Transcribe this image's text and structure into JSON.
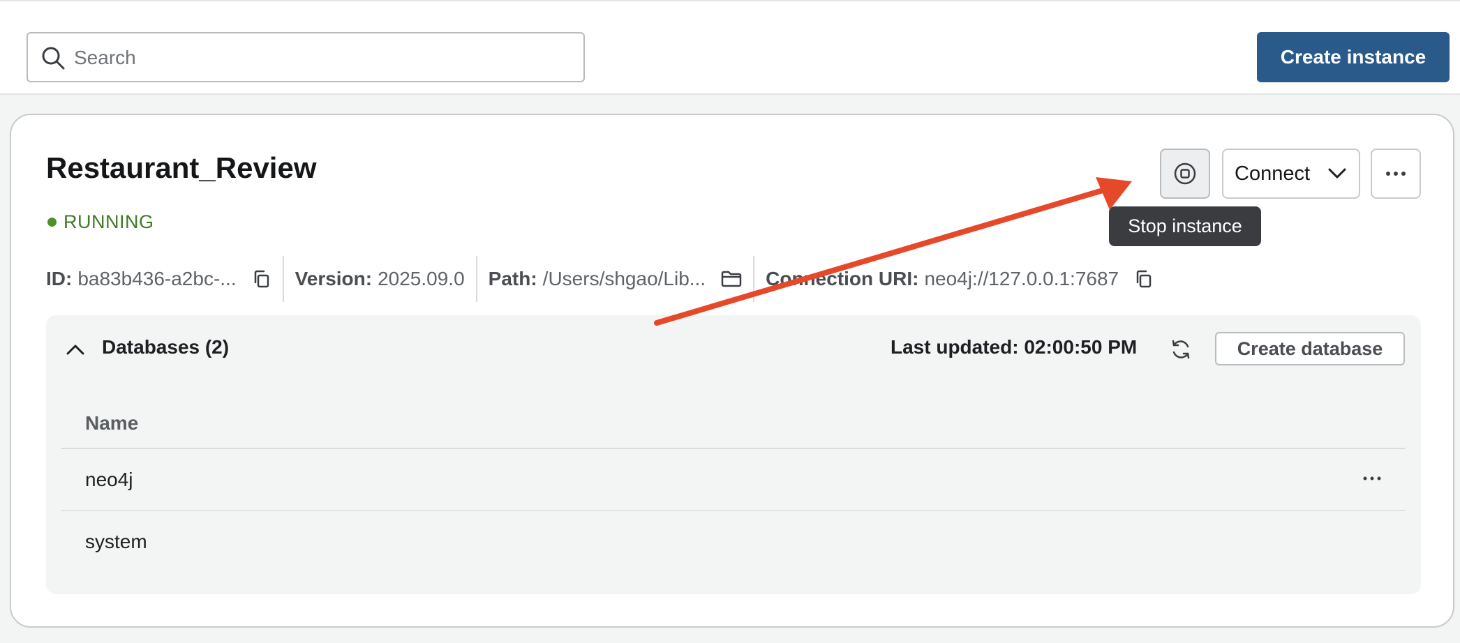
{
  "toolbar": {
    "search_placeholder": "Search",
    "create_instance_label": "Create instance"
  },
  "instance": {
    "name": "Restaurant_Review",
    "status": "RUNNING",
    "actions": {
      "stop_tooltip": "Stop instance",
      "connect_label": "Connect"
    },
    "meta": {
      "id_label": "ID:",
      "id_value": "ba83b436-a2bc-...",
      "version_label": "Version:",
      "version_value": "2025.09.0",
      "path_label": "Path:",
      "path_value": "/Users/shgao/Lib...",
      "uri_label": "Connection URI:",
      "uri_value": "neo4j://127.0.0.1:7687"
    }
  },
  "databases": {
    "heading": "Databases (2)",
    "last_updated": "Last updated: 02:00:50 PM",
    "create_label": "Create database",
    "column_name": "Name",
    "rows": [
      {
        "name": "neo4j"
      },
      {
        "name": "system"
      }
    ]
  },
  "colors": {
    "primary": "#2a5a8a",
    "running": "#3f7a24",
    "annotation_arrow": "#e5492a",
    "tooltip_bg": "#3a3c40"
  },
  "icons": {
    "search": "search-icon",
    "stop": "stop-icon",
    "chevron": "chevron-down-icon",
    "more": "more-horizontal-icon",
    "copy": "copy-icon",
    "folder": "folder-icon",
    "collapse": "chevron-up-icon",
    "refresh": "refresh-icon"
  }
}
